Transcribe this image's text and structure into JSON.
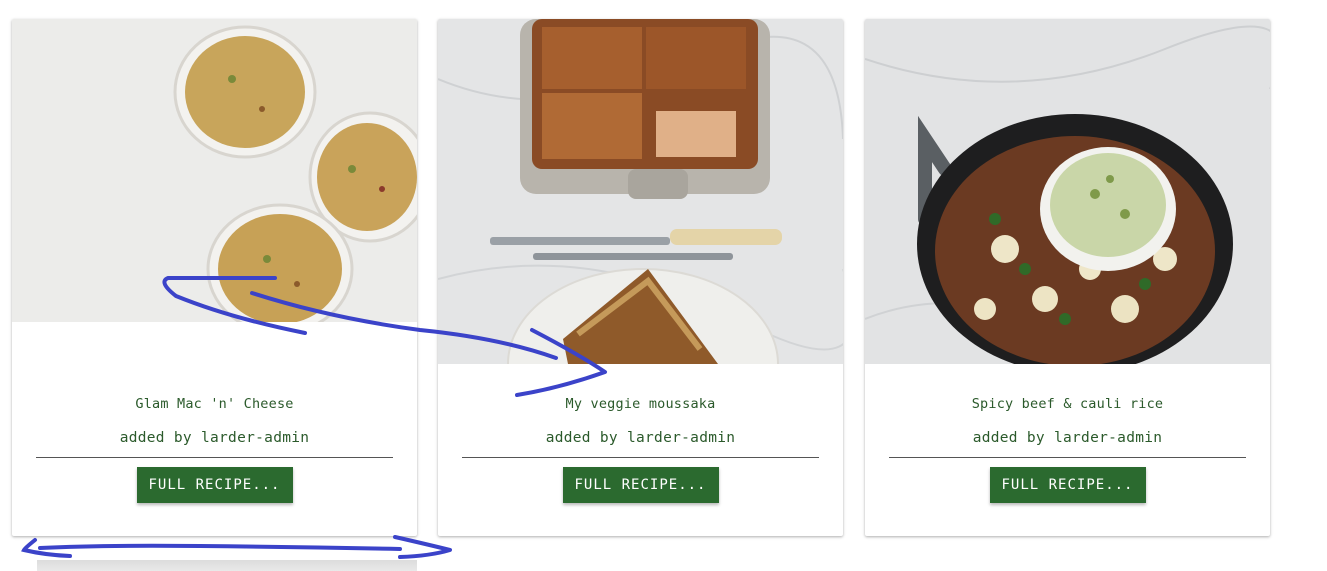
{
  "recipes": [
    {
      "title": "Glam Mac 'n' Cheese",
      "author": "added by larder-admin",
      "button_label": "FULL RECIPE...",
      "image": "mac-and-cheese-ramekins"
    },
    {
      "title": "My veggie moussaka",
      "author": "added by larder-admin",
      "button_label": "FULL RECIPE...",
      "image": "veggie-moussaka-dish"
    },
    {
      "title": "Spicy beef & cauli rice",
      "author": "added by larder-admin",
      "button_label": "FULL RECIPE...",
      "image": "beef-cauli-rice-pan"
    }
  ],
  "colors": {
    "accent_green": "#2b6a2f",
    "title_text": "#2b5a2b",
    "annotation_ink": "#3b43c9"
  }
}
